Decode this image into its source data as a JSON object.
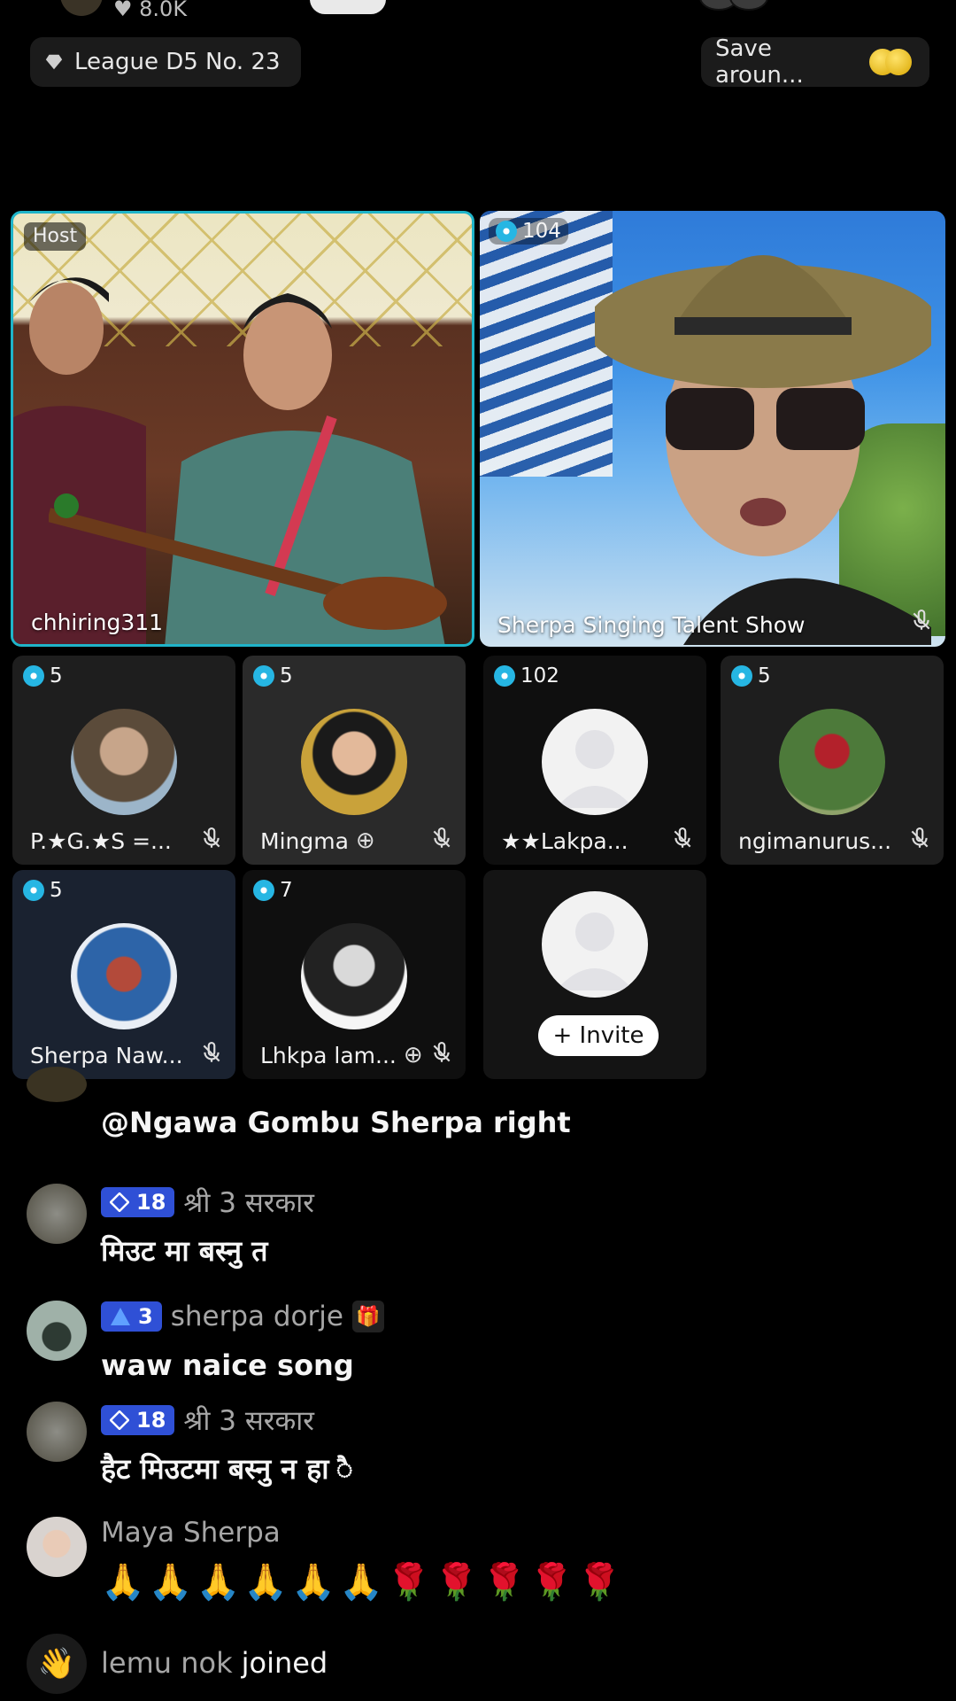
{
  "top": {
    "likes": "8.0K"
  },
  "league_label": "League D5 No. 23",
  "save_label": "Save aroun...",
  "host_tile": {
    "tag": "Host",
    "name": "chhiring311"
  },
  "guest_tile": {
    "count": "104",
    "name": "Sherpa Singing Talent Show"
  },
  "seats": [
    {
      "count": "5",
      "name": "P.★G.★S =..."
    },
    {
      "count": "5",
      "name": "Mingma"
    },
    {
      "count": "102",
      "name": "★★Lakpa..."
    },
    {
      "count": "5",
      "name": "ngimanurus..."
    },
    {
      "count": "5",
      "name": "Sherpa Naw..."
    },
    {
      "count": "7",
      "name": "Lhkpa lam..."
    }
  ],
  "invite_label": "+ Invite",
  "chat": [
    {
      "text": "@Ngawa Gombu Sherpa right"
    },
    {
      "level": "18",
      "user": "श्री 3 सरकार",
      "text": "मिउट मा बस्नु त"
    },
    {
      "level": "3",
      "user": "sherpa dorje",
      "text": "waw naice song"
    },
    {
      "level": "18",
      "user": "श्री 3 सरकार",
      "text": "हैट मिउटमा बस्नु न हा ै"
    },
    {
      "user": "Maya Sherpa",
      "text": "🙏🙏🙏🙏🙏🙏🌹🌹🌹🌹🌹"
    },
    {
      "user": "lemu nok",
      "text": "joined"
    }
  ],
  "colors": {
    "host_border": "#1fb4c9",
    "level_badge": "#2f50d6",
    "gem": "#26b6e3"
  },
  "icons": [
    "diamond-icon",
    "coin-icon",
    "gem-icon",
    "mic-muted-icon",
    "plus-icon",
    "gift-icon",
    "wave-icon"
  ]
}
